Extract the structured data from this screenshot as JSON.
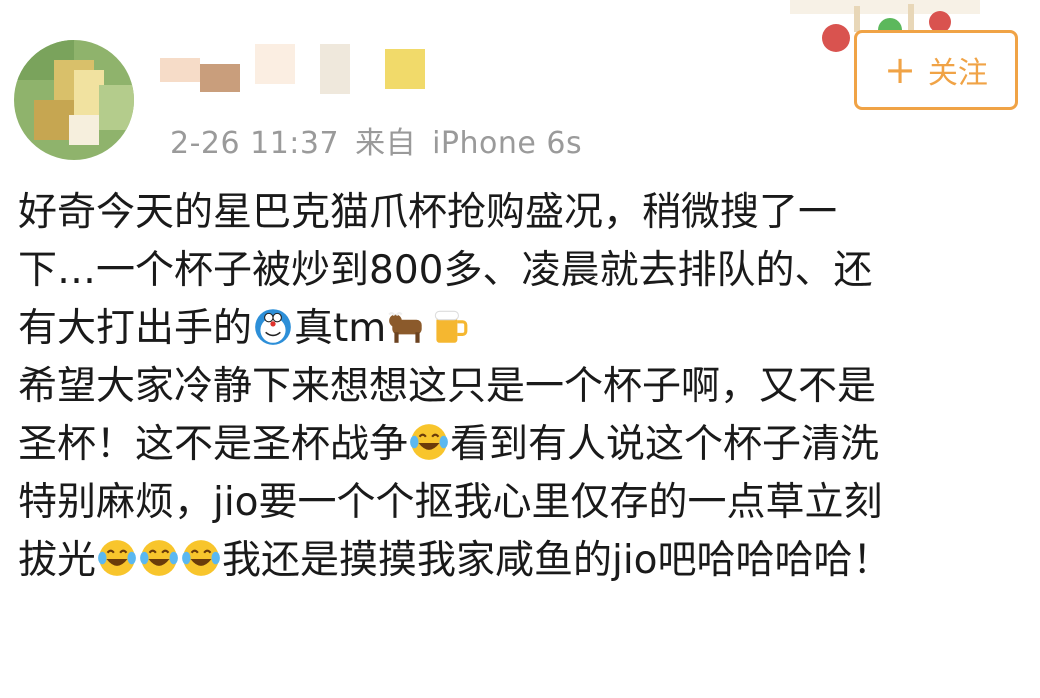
{
  "header": {
    "timestamp": "2-26 11:37",
    "source_prefix": "来自",
    "device": "iPhone 6s",
    "follow_button": {
      "plus": "+",
      "label": "关注"
    }
  },
  "post": {
    "lines": [
      [
        {
          "t": "text",
          "v": "好奇今天的星巴克猫爪杯抢购盛况，稍微搜了一"
        }
      ],
      [
        {
          "t": "text",
          "v": "下…一个杯子被炒到800多、凌晨就去排队的、还"
        }
      ],
      [
        {
          "t": "text",
          "v": "有大打出手的"
        },
        {
          "t": "emoji",
          "name": "doraemon-emoji"
        },
        {
          "t": "text",
          "v": "真tm"
        },
        {
          "t": "emoji",
          "name": "ox-emoji"
        },
        {
          "t": "emoji",
          "name": "beer-emoji"
        }
      ],
      [
        {
          "t": "text",
          "v": "希望大家冷静下来想想这只是一个杯子啊，又不是"
        }
      ],
      [
        {
          "t": "text",
          "v": "圣杯！这不是圣杯战争"
        },
        {
          "t": "emoji",
          "name": "laugh-cry-emoji"
        },
        {
          "t": "text",
          "v": "看到有人说这个杯子清洗"
        }
      ],
      [
        {
          "t": "text",
          "v": "特别麻烦，jio要一个个抠我心里仅存的一点草立刻"
        }
      ],
      [
        {
          "t": "text",
          "v": "拔光"
        },
        {
          "t": "emoji",
          "name": "laugh-cry-emoji"
        },
        {
          "t": "emoji",
          "name": "laugh-cry-emoji"
        },
        {
          "t": "emoji",
          "name": "laugh-cry-emoji"
        },
        {
          "t": "text",
          "v": "我还是摸摸我家咸鱼的jio吧哈哈哈哈！"
        }
      ]
    ]
  },
  "colors": {
    "accent": "#f0a346",
    "meta": "#9a9a9a",
    "text": "#1a1a1a"
  }
}
